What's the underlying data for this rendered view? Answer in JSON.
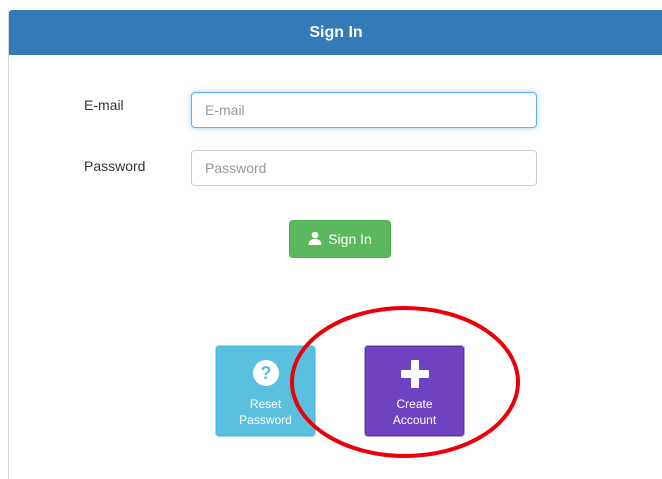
{
  "header": {
    "title": "Sign In"
  },
  "form": {
    "email_label": "E-mail",
    "email_placeholder": "E-mail",
    "email_value": "",
    "password_label": "Password",
    "password_placeholder": "Password",
    "password_value": ""
  },
  "signin_button": {
    "label": "Sign In",
    "icon": "user-icon"
  },
  "tiles": {
    "reset": {
      "line1": "Reset",
      "line2": "Password",
      "icon": "question-circle-icon"
    },
    "create": {
      "line1": "Create",
      "line2": "Account",
      "icon": "plus-icon"
    }
  },
  "colors": {
    "header": "#337ab7",
    "signin": "#5cb85c",
    "reset_tile": "#5bc0de",
    "create_tile": "#6f42c1",
    "annotation_ring": "#e8000b"
  }
}
